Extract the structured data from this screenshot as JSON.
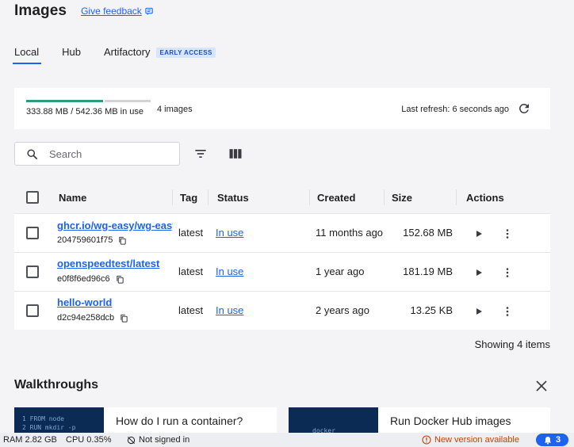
{
  "header": {
    "title": "Images",
    "feedback_label": "Give feedback"
  },
  "tabs": [
    {
      "label": "Local",
      "active": true
    },
    {
      "label": "Hub",
      "active": false
    },
    {
      "label": "Artifactory",
      "active": false,
      "badge": "EARLY ACCESS"
    }
  ],
  "usage": {
    "text": "333.88 MB / 542.36 MB in use",
    "count": "4 images",
    "used_fraction": 0.615,
    "last_refresh": "Last refresh: 6 seconds ago",
    "bar_color": "#2a9d7c"
  },
  "search": {
    "placeholder": "Search",
    "value": ""
  },
  "table": {
    "headers": {
      "name": "Name",
      "tag": "Tag",
      "status": "Status",
      "created": "Created",
      "size": "Size",
      "actions": "Actions"
    },
    "rows": [
      {
        "name": "ghcr.io/wg-easy/wg-easy",
        "id": "204759601f75",
        "tag": "latest",
        "status": "In use",
        "created": "11 months ago",
        "size": "152.68 MB"
      },
      {
        "name": "openspeedtest/latest",
        "id": "e0f8f6ed96c6",
        "tag": "latest",
        "status": "In use",
        "created": "1 year ago",
        "size": "181.19 MB"
      },
      {
        "name": "hello-world",
        "id": "d2c94e258dcb",
        "tag": "latest",
        "status": "In use",
        "created": "2 years ago",
        "size": "13.25 KB"
      }
    ],
    "footer": "Showing 4 items"
  },
  "walkthroughs": {
    "title": "Walkthroughs",
    "cards": [
      {
        "title": "How do I run a container?",
        "code": [
          "1 FROM node",
          "2 RUN mkdir -p"
        ]
      },
      {
        "title": "Run Docker Hub images",
        "code": [
          "docker"
        ]
      }
    ]
  },
  "statusbar": {
    "ram": "RAM 2.82 GB",
    "cpu": "CPU 0.35%",
    "signin": "Not signed in",
    "update": "New version available",
    "notifications": "3"
  },
  "colors": {
    "accent": "#1d63ed",
    "warning": "#c74200"
  }
}
